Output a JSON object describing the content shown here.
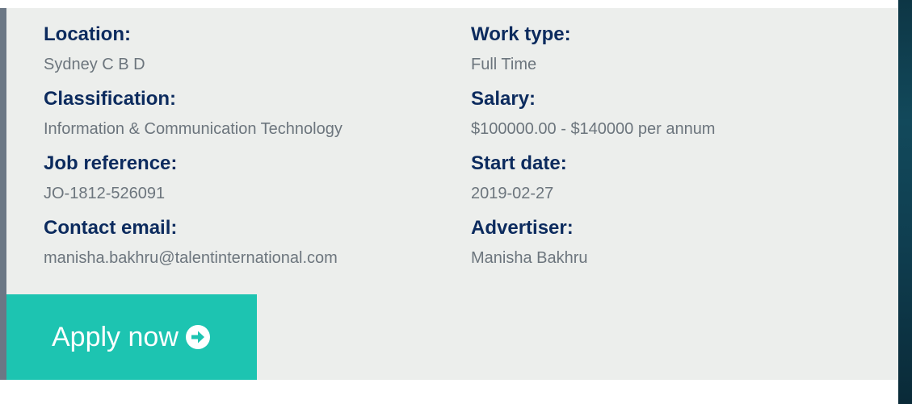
{
  "job_details": {
    "left": [
      {
        "label": "Location:",
        "value": "Sydney C B D"
      },
      {
        "label": "Classification:",
        "value": "Information & Communication Technology"
      },
      {
        "label": "Job reference:",
        "value": "JO-1812-526091"
      },
      {
        "label": "Contact email:",
        "value": "manisha.bakhru@talentinternational.com"
      }
    ],
    "right": [
      {
        "label": "Work type:",
        "value": "Full Time"
      },
      {
        "label": "Salary:",
        "value": "$100000.00 - $140000 per annum"
      },
      {
        "label": "Start date:",
        "value": "2019-02-27"
      },
      {
        "label": "Advertiser:",
        "value": "Manisha Bakhru"
      }
    ]
  },
  "apply_button": {
    "label": "Apply now",
    "icon": "arrow-circle-right-icon"
  },
  "colors": {
    "label": "#0c2b5e",
    "value": "#6c757d",
    "panel": "#eceeec",
    "button": "#1dc4b1"
  }
}
